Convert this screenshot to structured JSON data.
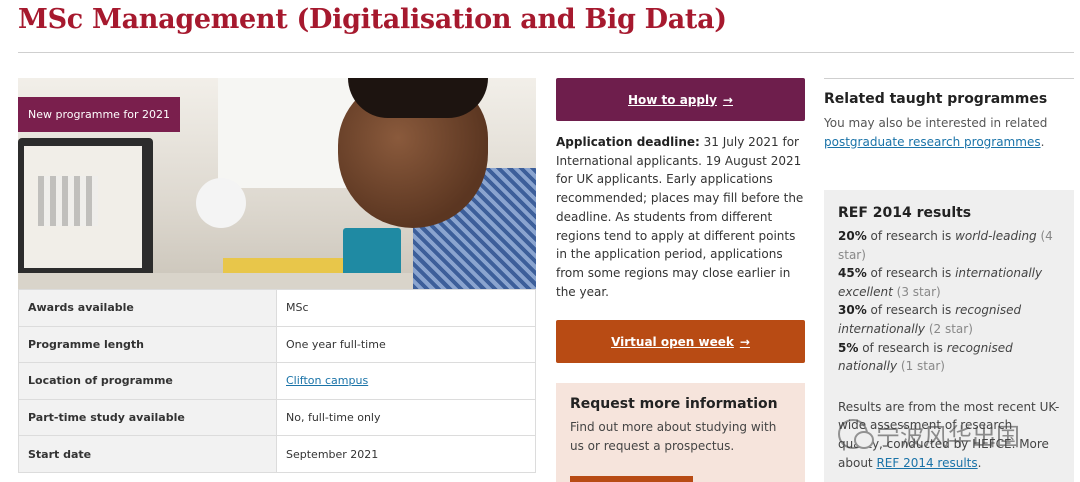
{
  "page": {
    "title": "MSc Management (Digitalisation and Big Data)"
  },
  "hero": {
    "badge": "New programme for 2021"
  },
  "facts": [
    {
      "key": "Awards available",
      "value": "MSc"
    },
    {
      "key": "Programme length",
      "value": "One year full-time"
    },
    {
      "key": "Location of programme",
      "value": "Clifton campus",
      "is_link": true
    },
    {
      "key": "Part-time study available",
      "value": "No, full-time only"
    },
    {
      "key": "Start date",
      "value": "September 2021"
    }
  ],
  "apply": {
    "label": "How to apply",
    "icon": "arrow-right-icon"
  },
  "deadline": {
    "label": "Application deadline:",
    "text": " 31 July 2021 for International applicants. 19 August 2021 for UK applicants. Early applications recommended; places may fill before the deadline. As students from different regions tend to apply at different points in the application period, applications from some regions may close earlier in the year."
  },
  "open_week": {
    "label": "Virtual open week",
    "icon": "arrow-right-icon"
  },
  "request": {
    "title": "Request more information",
    "text": "Find out more about studying with us or request a prospectus."
  },
  "related": {
    "title": "Related taught programmes",
    "text": "You may also be interested in related ",
    "link": "postgraduate research programmes",
    "suffix": "."
  },
  "ref": {
    "title": "REF 2014 results",
    "rows": [
      {
        "pct": "20%",
        "mid": " of research is ",
        "em": "world-leading",
        "star": " (4 star)"
      },
      {
        "pct": "45%",
        "mid": " of research is ",
        "em": "internationally excellent",
        "star": " (3 star)"
      },
      {
        "pct": "30%",
        "mid": " of research is ",
        "em": "recognised internationally",
        "star": " (2 star)"
      },
      {
        "pct": "5%",
        "mid": " of research is ",
        "em": "recognised nationally",
        "star": " (1 star)"
      }
    ],
    "note_pre": "Results are from the most recent UK-wide assessment of research quality, conducted by HEFCE. More about ",
    "note_link": "REF 2014 results",
    "note_post": "."
  },
  "watermark": {
    "text": "宁波风华出国"
  },
  "colors": {
    "title": "#a6192e",
    "apply_button": "#6e1e4c",
    "open_week_button": "#b84b14",
    "link": "#1a73a8",
    "request_bg": "#f6e4dc",
    "ref_bg": "#efefef"
  }
}
